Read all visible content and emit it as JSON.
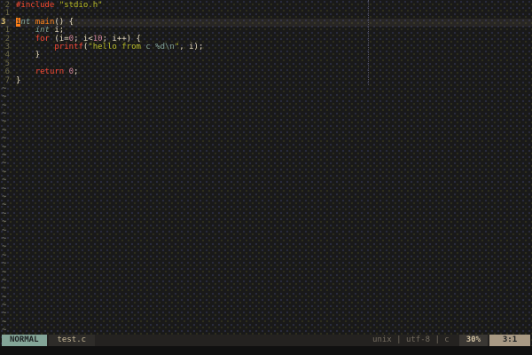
{
  "colors": {
    "keyword": "#fb4934",
    "function": "#fe8019",
    "type": "#83a598",
    "string": "#b8bb26",
    "special": "#83a598",
    "number": "#d3869b",
    "fg": "#e8dcc0",
    "line_number": "#6e6a48",
    "current_line_number": "#dfc173",
    "tilde": "#8f8f82",
    "cursor_bg": "#fe8019",
    "mode_bg": "#83a598",
    "position_bg": "#a89984"
  },
  "editor": {
    "tilde_symbol": "~",
    "tilde_count": 30,
    "lines": [
      {
        "num": "2",
        "cur": false,
        "tokens": [
          {
            "t": "#include ",
            "c": "keyword"
          },
          {
            "t": "\"stdio.h\"",
            "c": "string"
          }
        ]
      },
      {
        "num": "1",
        "cur": false,
        "tokens": []
      },
      {
        "num": "3",
        "cur": true,
        "tokens": [
          {
            "t": "i",
            "c": "type",
            "cursor": true
          },
          {
            "t": "nt",
            "c": "type",
            "i": true
          },
          {
            "t": " ",
            "c": "fg"
          },
          {
            "t": "main",
            "c": "function"
          },
          {
            "t": "() {",
            "c": "fg"
          }
        ]
      },
      {
        "num": "1",
        "cur": false,
        "tokens": [
          {
            "t": "    ",
            "c": "fg"
          },
          {
            "t": "int",
            "c": "type",
            "i": true
          },
          {
            "t": " i;",
            "c": "fg"
          }
        ]
      },
      {
        "num": "2",
        "cur": false,
        "tokens": [
          {
            "t": "    ",
            "c": "fg"
          },
          {
            "t": "for",
            "c": "keyword"
          },
          {
            "t": " (i=",
            "c": "fg"
          },
          {
            "t": "0",
            "c": "number"
          },
          {
            "t": "; i<",
            "c": "fg"
          },
          {
            "t": "10",
            "c": "number"
          },
          {
            "t": "; i++) {",
            "c": "fg"
          }
        ]
      },
      {
        "num": "3",
        "cur": false,
        "tokens": [
          {
            "t": "        ",
            "c": "fg"
          },
          {
            "t": "printf",
            "c": "keyword"
          },
          {
            "t": "(",
            "c": "fg"
          },
          {
            "t": "\"hello from ",
            "c": "string"
          },
          {
            "t": "c %d\\n",
            "c": "special"
          },
          {
            "t": "\"",
            "c": "string"
          },
          {
            "t": ", i);",
            "c": "fg"
          }
        ]
      },
      {
        "num": "4",
        "cur": false,
        "tokens": [
          {
            "t": "    }",
            "c": "fg"
          }
        ]
      },
      {
        "num": "5",
        "cur": false,
        "tokens": []
      },
      {
        "num": "6",
        "cur": false,
        "tokens": [
          {
            "t": "    ",
            "c": "fg"
          },
          {
            "t": "return",
            "c": "keyword"
          },
          {
            "t": " ",
            "c": "fg"
          },
          {
            "t": "0",
            "c": "number"
          },
          {
            "t": ";",
            "c": "fg"
          }
        ]
      },
      {
        "num": "7",
        "cur": false,
        "tokens": [
          {
            "t": "}",
            "c": "fg"
          }
        ]
      }
    ]
  },
  "statusline": {
    "mode": "NORMAL",
    "filename": "test.c",
    "fileinfo": "unix | utf-8 | c",
    "percent": "30%",
    "position": "3:1"
  }
}
